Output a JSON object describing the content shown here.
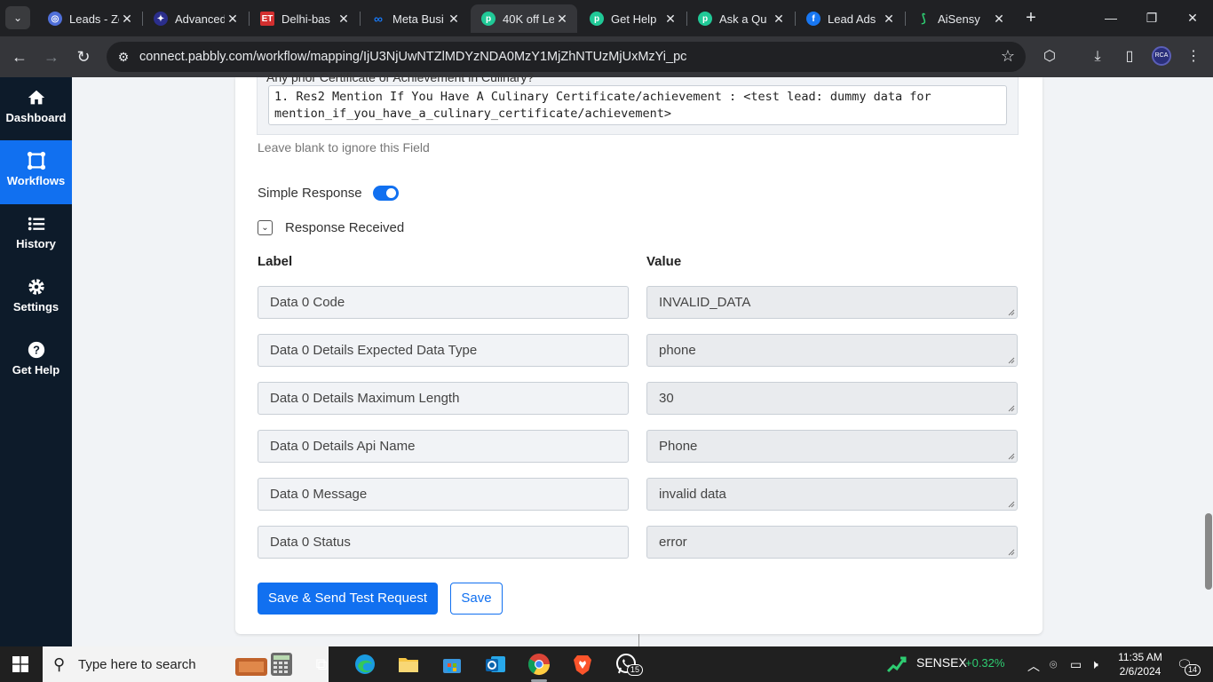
{
  "browser": {
    "tabs": [
      {
        "title": "Leads - Zo",
        "icon": "zoho-icon",
        "color": "#4f6fd9"
      },
      {
        "title": "Advanced",
        "icon": "star-logo-icon",
        "color": "#2b2e8c"
      },
      {
        "title": "Delhi-bas",
        "icon": "et-icon",
        "color": "#d32f2f"
      },
      {
        "title": "Meta Busi",
        "icon": "meta-icon",
        "color": "#1877f2"
      },
      {
        "title": "40K off Le",
        "icon": "pabbly-icon",
        "color": "#20c997",
        "active": true
      },
      {
        "title": "Get Help",
        "icon": "pabbly-icon",
        "color": "#20c997"
      },
      {
        "title": "Ask a Qu",
        "icon": "pabbly-icon",
        "color": "#20c997"
      },
      {
        "title": "Lead Ads",
        "icon": "facebook-icon",
        "color": "#1877f2"
      },
      {
        "title": "AiSensy",
        "icon": "aisensy-icon",
        "color": "#2ecc71"
      }
    ],
    "url": "connect.pabbly.com/workflow/mapping/IjU3NjUwNTZlMDYzNDA0MzY1MjZhNTUzMjUxMzYi_pc",
    "profile_initials": "RCA"
  },
  "sidebar": {
    "items": [
      {
        "label": "Dashboard",
        "icon": "home-icon"
      },
      {
        "label": "Workflows",
        "icon": "workflow-icon",
        "active": true
      },
      {
        "label": "History",
        "icon": "history-icon"
      },
      {
        "label": "Settings",
        "icon": "gear-icon"
      },
      {
        "label": "Get Help",
        "icon": "help-icon"
      }
    ]
  },
  "main": {
    "mapping_label": "Any prior Certificate or Achievement in Culinary?",
    "mapping_value": "1. Res2 Mention If You Have A Culinary Certificate/achievement : <test lead: dummy data for mention_if_you_have_a_culinary_certificate/achievement>",
    "hint": "Leave blank to ignore this Field",
    "simple_response_label": "Simple Response",
    "simple_response_on": true,
    "response_received_label": "Response Received",
    "label_header": "Label",
    "value_header": "Value",
    "rows": [
      {
        "label": "Data 0 Code",
        "value": "INVALID_DATA"
      },
      {
        "label": "Data 0 Details Expected Data Type",
        "value": "phone"
      },
      {
        "label": "Data 0 Details Maximum Length",
        "value": "30"
      },
      {
        "label": "Data 0 Details Api Name",
        "value": "Phone"
      },
      {
        "label": "Data 0 Message",
        "value": "invalid data"
      },
      {
        "label": "Data 0 Status",
        "value": "error"
      }
    ],
    "save_send_label": "Save & Send Test Request",
    "save_label": "Save",
    "accent_color": "#1170f0"
  },
  "taskbar": {
    "search_placeholder": "Type here to search",
    "whatsapp_badge": "15",
    "sensex_label": "SENSEX",
    "sensex_change": "+0.32%",
    "time": "11:35 AM",
    "date": "2/6/2024",
    "notification_count": "14"
  }
}
